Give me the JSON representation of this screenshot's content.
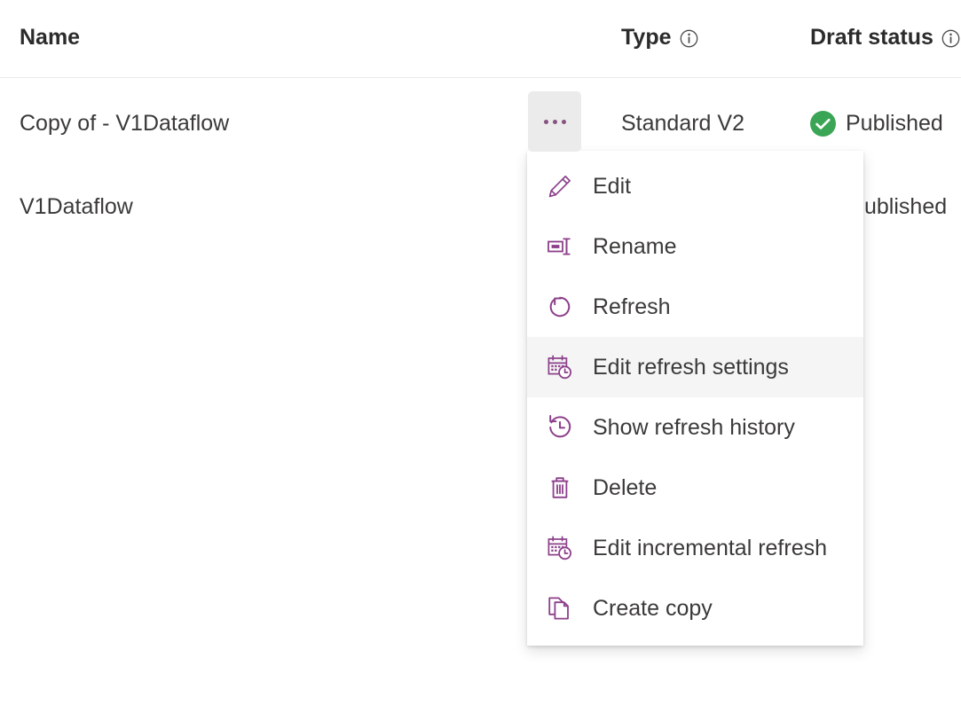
{
  "table": {
    "columns": [
      {
        "key": "name",
        "label": "Name",
        "info_icon": false
      },
      {
        "key": "type",
        "label": "Type",
        "info_icon": true,
        "info_icon_name": "info-icon"
      },
      {
        "key": "draft",
        "label": "Draft status",
        "info_icon": true,
        "info_icon_name": "info-icon"
      }
    ],
    "rows": [
      {
        "name": "Copy of - V1Dataflow",
        "type": "Standard V2",
        "draft_status": "Published",
        "draft_status_icon": "checkmark-circle-icon",
        "draft_status_color": "#3AA655"
      },
      {
        "name": "V1Dataflow",
        "type": "",
        "draft_status": "ublished",
        "draft_status_icon": "",
        "draft_status_color": "#3AA655"
      }
    ]
  },
  "overflow_button": {
    "name": "more-options-button",
    "icon": "ellipsis-icon",
    "label": "..."
  },
  "context_menu": {
    "items": [
      {
        "label": "Edit",
        "icon": "pencil-icon",
        "selected": false
      },
      {
        "label": "Rename",
        "icon": "rename-icon",
        "selected": false
      },
      {
        "label": "Refresh",
        "icon": "refresh-icon",
        "selected": false
      },
      {
        "label": "Edit refresh settings",
        "icon": "calendar-clock-icon",
        "selected": true
      },
      {
        "label": "Show refresh history",
        "icon": "history-clock-icon",
        "selected": false
      },
      {
        "label": "Delete",
        "icon": "trash-icon",
        "selected": false
      },
      {
        "label": "Edit incremental refresh",
        "icon": "calendar-clock-icon",
        "selected": false
      },
      {
        "label": "Create copy",
        "icon": "copy-pages-icon",
        "selected": false
      }
    ]
  },
  "colors": {
    "accent_purple": "#8C3F8A",
    "published_green": "#3AA655",
    "selected_row_bg": "#F5F5F5",
    "button_bg": "#EBEBEB",
    "divider": "#EDEBE9",
    "text": "#3B3A39"
  }
}
